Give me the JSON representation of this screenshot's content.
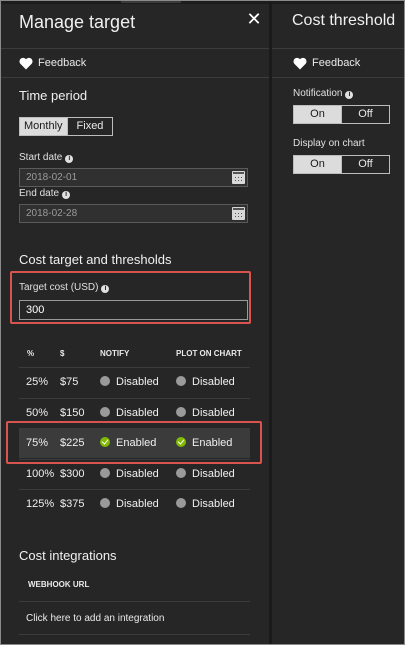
{
  "left_blade": {
    "title": "Manage target",
    "feedback_label": "Feedback",
    "time_period": {
      "heading": "Time period",
      "options": [
        "Monthly",
        "Fixed"
      ],
      "selected": "Monthly",
      "start_date_label": "Start date",
      "start_date_value": "2018-02-01",
      "end_date_label": "End date",
      "end_date_value": "2018-02-28"
    },
    "cost_target": {
      "heading": "Cost target and thresholds",
      "target_label": "Target cost (USD)",
      "target_value": "300"
    },
    "table": {
      "headers": [
        "%",
        "$",
        "NOTIFY",
        "PLOT ON CHART"
      ],
      "rows": [
        {
          "pct": "25%",
          "amount": "$75",
          "notify": "Disabled",
          "plot": "Disabled",
          "enabled": false
        },
        {
          "pct": "50%",
          "amount": "$150",
          "notify": "Disabled",
          "plot": "Disabled",
          "enabled": false
        },
        {
          "pct": "75%",
          "amount": "$225",
          "notify": "Enabled",
          "plot": "Enabled",
          "enabled": true
        },
        {
          "pct": "100%",
          "amount": "$300",
          "notify": "Disabled",
          "plot": "Disabled",
          "enabled": false
        },
        {
          "pct": "125%",
          "amount": "$375",
          "notify": "Disabled",
          "plot": "Disabled",
          "enabled": false
        }
      ]
    },
    "integrations": {
      "heading": "Cost integrations",
      "column_header": "WEBHOOK URL",
      "add_link": "Click here to add an integration"
    }
  },
  "right_blade": {
    "title": "Cost threshold",
    "feedback_label": "Feedback",
    "notification_label": "Notification",
    "notification_options": [
      "On",
      "Off"
    ],
    "notification_selected": "On",
    "display_label": "Display on chart",
    "display_options": [
      "On",
      "Off"
    ],
    "display_selected": "On"
  },
  "colors": {
    "background": "#262626",
    "highlight_border": "#d9534f",
    "enabled_green": "#7fba00",
    "disabled_gray": "#9a9a9a"
  }
}
